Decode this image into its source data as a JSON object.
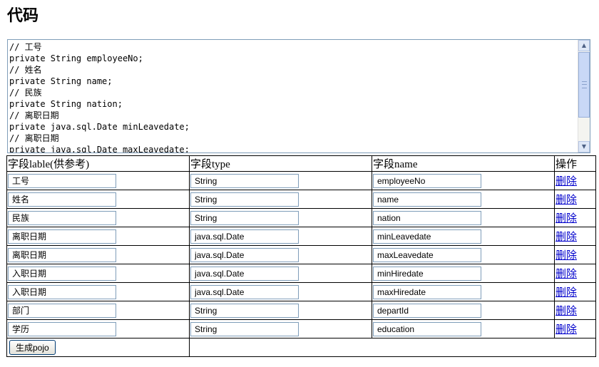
{
  "page": {
    "title": "代码"
  },
  "code": {
    "lines": [
      "// 工号",
      "private String employeeNo;",
      "// 姓名",
      "private String name;",
      "// 民族",
      "private String nation;",
      "// 离职日期",
      "private java.sql.Date minLeavedate;",
      "// 离职日期",
      "private java.sql.Date maxLeavedate;"
    ]
  },
  "table": {
    "headers": [
      "字段lable(供参考)",
      "字段type",
      "字段name",
      "操作"
    ],
    "delete_label": "删除",
    "rows": [
      {
        "label": "工号",
        "type": "String",
        "name": "employeeNo"
      },
      {
        "label": "姓名",
        "type": "String",
        "name": "name"
      },
      {
        "label": "民族",
        "type": "String",
        "name": "nation"
      },
      {
        "label": "离职日期",
        "type": "java.sql.Date",
        "name": "minLeavedate"
      },
      {
        "label": "离职日期",
        "type": "java.sql.Date",
        "name": "maxLeavedate"
      },
      {
        "label": "入职日期",
        "type": "java.sql.Date",
        "name": "minHiredate"
      },
      {
        "label": "入职日期",
        "type": "java.sql.Date",
        "name": "maxHiredate"
      },
      {
        "label": "部门",
        "type": "String",
        "name": "departId"
      },
      {
        "label": "学历",
        "type": "String",
        "name": "education"
      }
    ]
  },
  "actions": {
    "generate_label": "生成pojo"
  }
}
